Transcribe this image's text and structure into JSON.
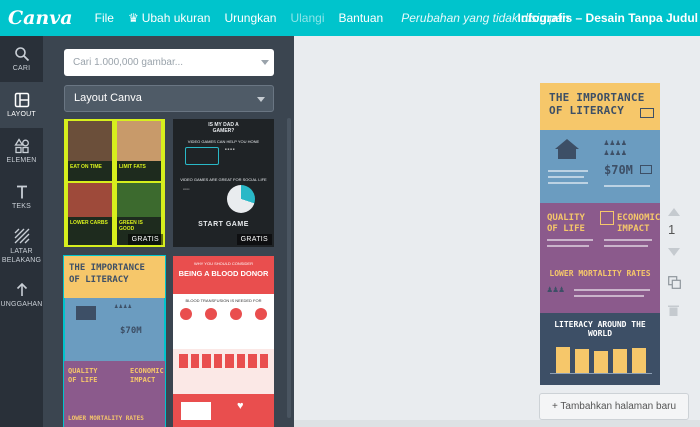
{
  "topbar": {
    "logo": "Canva",
    "menu_file": "File",
    "menu_resize": "Ubah ukuran",
    "menu_undo": "Urungkan",
    "menu_redo": "Ulangi",
    "menu_help": "Bantuan",
    "status": "Perubahan yang tidak disimpan",
    "doc_title": "Infografis – Desain Tanpa Judul"
  },
  "sidebar": {
    "items": [
      {
        "label": "CARI",
        "icon": "search-icon"
      },
      {
        "label": "LAYOUT",
        "icon": "layout-icon"
      },
      {
        "label": "ELEMEN",
        "icon": "shapes-icon"
      },
      {
        "label": "TEKS",
        "icon": "text-icon"
      },
      {
        "label": "LATAR BELAKANG",
        "icon": "background-icon"
      },
      {
        "label": "UNGGAHAN",
        "icon": "upload-icon"
      }
    ]
  },
  "panel": {
    "search_placeholder": "Cari 1.000,000 gambar...",
    "category_selected": "Layout Canva",
    "badge_free": "GRATIS",
    "templates": [
      {
        "lines": [
          "EAT ON TIME",
          "LIMIT FATS",
          "LOWER CARBS",
          "GREEN IS GOOD"
        ]
      },
      {
        "lines": [
          "IS MY DAD A",
          "GAMER?",
          "VIDEO GAMES CAN HELP YOU HONE",
          "VIDEO GAMES ARE GREAT FOR SOCIAL LIFE",
          "START GAME"
        ]
      },
      {
        "lines": [
          "THE IMPORTANCE",
          "OF LITERACY",
          "QUALITY",
          "OF LIFE",
          "ECONOMIC",
          "IMPACT",
          "LOWER MORTALITY RATES"
        ]
      },
      {
        "lines": [
          "WHY YOU SHOULD CONSIDER",
          "BEING A BLOOD DONOR",
          "BLOOD TRANSFUSION IS NEEDED FOR"
        ]
      }
    ]
  },
  "canvas": {
    "page_number": "1",
    "add_page": "+ Tambahkan halaman baru",
    "infographic": {
      "title_line1": "THE IMPORTANCE",
      "title_line2": "OF LITERACY",
      "stat": "$70M",
      "quality_line1": "QUALITY",
      "quality_line2": "OF LIFE",
      "economic_line1": "ECONOMIC",
      "economic_line2": "IMPACT",
      "mortality": "LOWER MORTALITY RATES",
      "world": "LITERACY AROUND THE WORLD"
    }
  },
  "colors": {
    "topbar": "#00c4cc",
    "rail": "#293039",
    "panel": "#3b4550",
    "info_yellow": "#f6c76a",
    "info_blue": "#6b9cc0",
    "info_purple": "#8b5a8c",
    "info_dark": "#3d4f66"
  }
}
